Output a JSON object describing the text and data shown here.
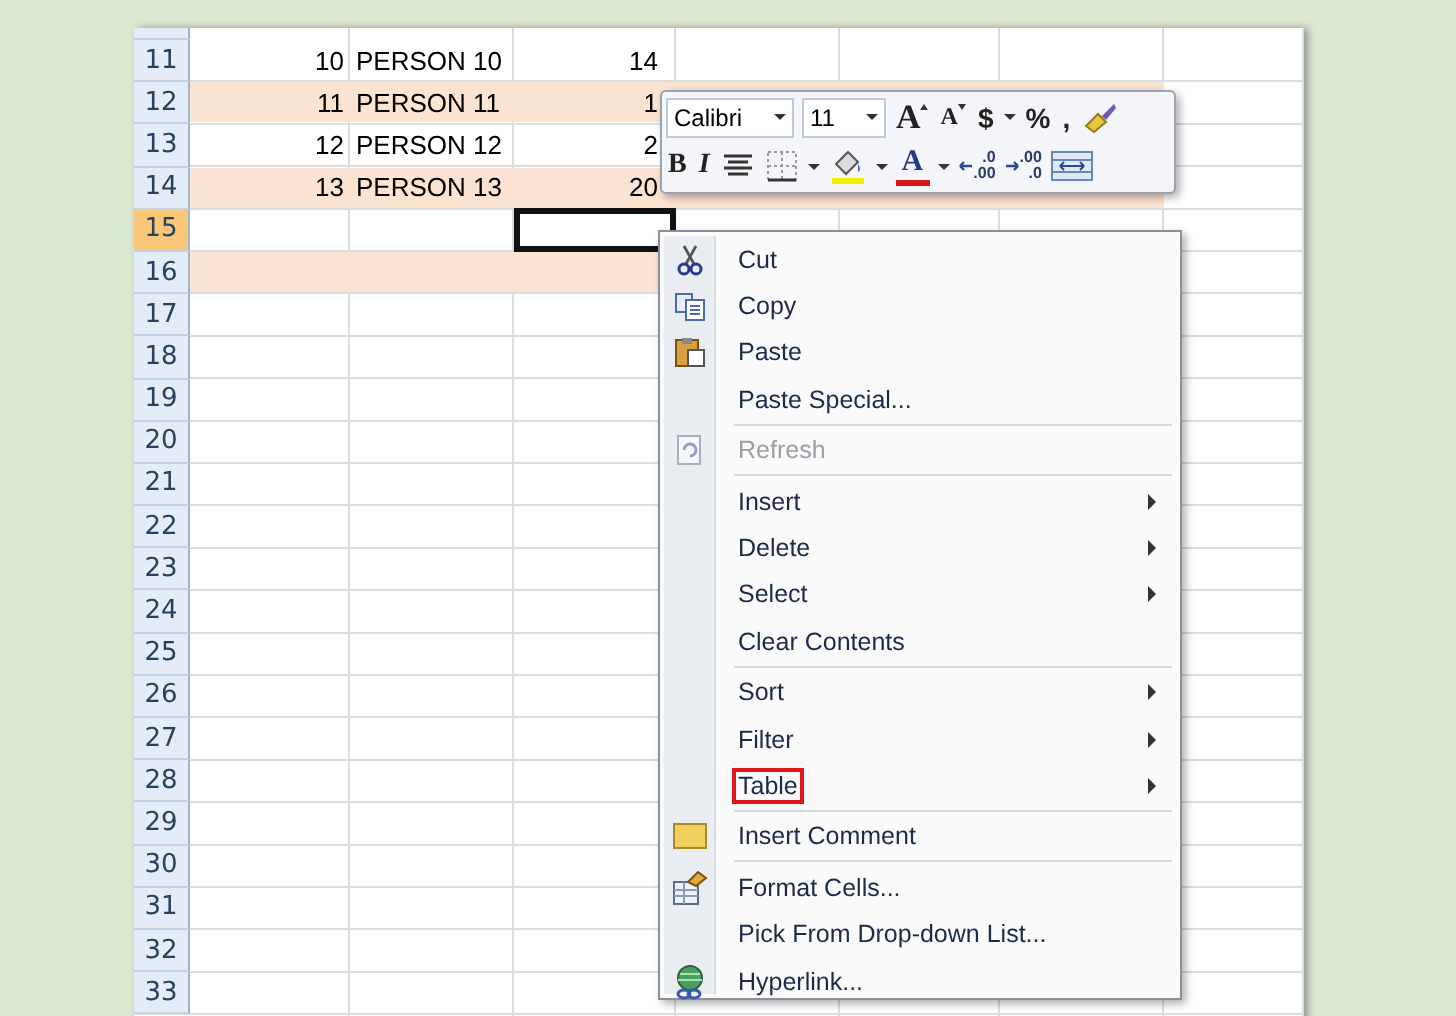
{
  "sheet": {
    "rows": [
      {
        "number": "11",
        "selected": false,
        "shaded": false,
        "cells": [
          {
            "text": "10",
            "selected": false
          },
          {
            "text": "PERSON 10",
            "selected": false
          },
          {
            "text": "14",
            "selected": false
          }
        ]
      },
      {
        "number": "12",
        "selected": false,
        "shaded": true,
        "cells": [
          {
            "text": "11",
            "selected": false
          },
          {
            "text": "PERSON 11",
            "selected": false
          },
          {
            "text": "1",
            "selected": false
          }
        ]
      },
      {
        "number": "13",
        "selected": false,
        "shaded": false,
        "cells": [
          {
            "text": "12",
            "selected": false
          },
          {
            "text": "PERSON 12",
            "selected": false
          },
          {
            "text": "2",
            "selected": false
          }
        ]
      },
      {
        "number": "14",
        "selected": false,
        "shaded": true,
        "cells": [
          {
            "text": "13",
            "selected": false
          },
          {
            "text": "PERSON 13",
            "selected": false
          },
          {
            "text": "20",
            "selected": false
          }
        ]
      },
      {
        "number": "15",
        "selected": true,
        "shaded": false,
        "cells": [
          {
            "selected": false
          },
          {
            "selected": false
          },
          {
            "selected": true
          }
        ]
      },
      {
        "number": "16",
        "selected": false,
        "shaded": true
      },
      {
        "number": "17",
        "selected": false,
        "shaded": false
      },
      {
        "number": "18",
        "selected": false,
        "shaded": false
      },
      {
        "number": "19",
        "selected": false,
        "shaded": false
      },
      {
        "number": "20",
        "selected": false,
        "shaded": false
      },
      {
        "number": "21",
        "selected": false,
        "shaded": false
      },
      {
        "number": "22",
        "selected": false,
        "shaded": false
      },
      {
        "number": "23",
        "selected": false,
        "shaded": false
      },
      {
        "number": "24",
        "selected": false,
        "shaded": false
      },
      {
        "number": "25",
        "selected": false,
        "shaded": false
      },
      {
        "number": "26",
        "selected": false,
        "shaded": false
      },
      {
        "number": "27",
        "selected": false,
        "shaded": false
      },
      {
        "number": "28",
        "selected": false,
        "shaded": false
      },
      {
        "number": "29",
        "selected": false,
        "shaded": false
      },
      {
        "number": "30",
        "selected": false,
        "shaded": false
      },
      {
        "number": "31",
        "selected": false,
        "shaded": false
      },
      {
        "number": "32",
        "selected": false,
        "shaded": false
      },
      {
        "number": "33",
        "selected": false,
        "shaded": false
      }
    ]
  },
  "mini_toolbar": {
    "font": "Calibri",
    "size": "11",
    "row_1": [
      {
        "kind": "grow-font",
        "label": "A"
      },
      {
        "kind": "shrink-font",
        "label": "A"
      },
      {
        "kind": "currency",
        "label": "$",
        "dropdown": true
      },
      {
        "kind": "percent",
        "label": "%"
      },
      {
        "kind": "comma",
        "label": ","
      },
      {
        "kind": "format-painter"
      }
    ],
    "row_2": [
      {
        "kind": "bold",
        "label": "B"
      },
      {
        "kind": "italic",
        "label": "I"
      },
      {
        "kind": "center"
      },
      {
        "kind": "borders",
        "dropdown": true
      },
      {
        "kind": "fill-color",
        "dropdown": true,
        "color": "#f2ee00"
      },
      {
        "kind": "font-color",
        "label": "A",
        "dropdown": true,
        "color": "#d81818"
      },
      {
        "kind": "increase-decimal",
        "top": ".0",
        "bottom": ".00"
      },
      {
        "kind": "decrease-decimal",
        "top": ".00",
        "bottom": ".0"
      },
      {
        "kind": "merge"
      }
    ]
  },
  "context_menu": {
    "items": [
      {
        "kind": "item",
        "label": "Cut",
        "disabled": false,
        "submenu": false,
        "highlighted": false
      },
      {
        "kind": "item",
        "label": "Copy",
        "disabled": false,
        "submenu": false,
        "highlighted": false
      },
      {
        "kind": "item",
        "label": "Paste",
        "disabled": false,
        "submenu": false,
        "highlighted": false
      },
      {
        "kind": "item",
        "label": "Paste Special...",
        "disabled": false,
        "submenu": false,
        "highlighted": false
      },
      {
        "kind": "separator"
      },
      {
        "kind": "item",
        "label": "Refresh",
        "disabled": true,
        "submenu": false,
        "highlighted": false
      },
      {
        "kind": "separator"
      },
      {
        "kind": "item",
        "label": "Insert",
        "disabled": false,
        "submenu": true,
        "highlighted": false
      },
      {
        "kind": "item",
        "label": "Delete",
        "disabled": false,
        "submenu": true,
        "highlighted": false
      },
      {
        "kind": "item",
        "label": "Select",
        "disabled": false,
        "submenu": true,
        "highlighted": false
      },
      {
        "kind": "item",
        "label": "Clear Contents",
        "disabled": false,
        "submenu": false,
        "highlighted": false
      },
      {
        "kind": "separator"
      },
      {
        "kind": "item",
        "label": "Sort",
        "disabled": false,
        "submenu": true,
        "highlighted": false
      },
      {
        "kind": "item",
        "label": "Filter",
        "disabled": false,
        "submenu": true,
        "highlighted": false
      },
      {
        "kind": "item",
        "label": "Table",
        "disabled": false,
        "submenu": true,
        "highlighted": true
      },
      {
        "kind": "separator"
      },
      {
        "kind": "item",
        "label": "Insert Comment",
        "disabled": false,
        "submenu": false,
        "highlighted": false
      },
      {
        "kind": "separator"
      },
      {
        "kind": "item",
        "label": "Format Cells...",
        "disabled": false,
        "submenu": false,
        "highlighted": false
      },
      {
        "kind": "item",
        "label": "Pick From Drop-down List...",
        "disabled": false,
        "submenu": false,
        "highlighted": false
      },
      {
        "kind": "item",
        "label": "Hyperlink...",
        "disabled": false,
        "submenu": false,
        "highlighted": false
      }
    ]
  }
}
